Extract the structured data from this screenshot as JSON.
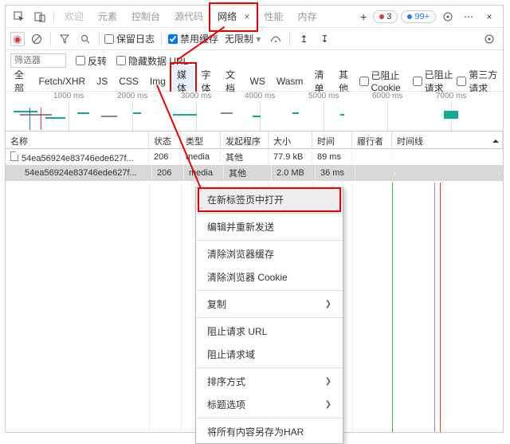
{
  "topTabs": {
    "welcome": "欢迎",
    "elements": "元素",
    "console": "控制台",
    "sources": "源代码",
    "network": "网络",
    "performance": "性能",
    "memory": "内存"
  },
  "badges": {
    "errors": "3",
    "other": "99+"
  },
  "toolbar2": {
    "preserveLog": "保留日志",
    "disableCache": "禁用缓存",
    "throttling": "无限制"
  },
  "filterRow": {
    "placeholder": "筛选器",
    "invert": "反转",
    "hideDataUrls": "隐藏数据 URL"
  },
  "typeFilters": {
    "all": "全部",
    "fetchxhr": "Fetch/XHR",
    "js": "JS",
    "css": "CSS",
    "img": "Img",
    "media": "媒体",
    "font": "字体",
    "doc": "文档",
    "ws": "WS",
    "wasm": "Wasm",
    "manifest": "清单",
    "other": "其他",
    "blockedCookies": "已阻止 Cookie",
    "blockedRequests": "已阻止请求",
    "thirdParty": "第三方请求"
  },
  "ruler": {
    "t1": "1000 ms",
    "t2": "2000 ms",
    "t3": "3000 ms",
    "t4": "4000 ms",
    "t5": "5000 ms",
    "t6": "6000 ms",
    "t7": "7000 ms"
  },
  "columns": {
    "name": "名称",
    "status": "状态",
    "type": "类型",
    "initiator": "发起程序",
    "size": "大小",
    "time": "时间",
    "fulfilled": "履行者",
    "waterfall": "时间线"
  },
  "rows": [
    {
      "name": "54ea56924e83746ede627f...",
      "status": "206",
      "type": "media",
      "initiator": "其他",
      "size": "77.9 kB",
      "time": "89 ms",
      "fulfilled": ""
    },
    {
      "name": "54ea56924e83746ede627f...",
      "status": "206",
      "type": "media",
      "initiator": "其他",
      "size": "2.0 MB",
      "time": "36 ms",
      "fulfilled": ""
    }
  ],
  "ctx": {
    "openNewTab": "在新标签页中打开",
    "editResend": "编辑并重新发送",
    "clearCache": "清除浏览器缓存",
    "clearCookies": "清除浏览器 Cookie",
    "copy": "复制",
    "blockUrl": "阻止请求 URL",
    "blockDomain": "阻止请求域",
    "sortBy": "排序方式",
    "headerOptions": "标题选项",
    "saveHar": "将所有内容另存为HAR"
  }
}
